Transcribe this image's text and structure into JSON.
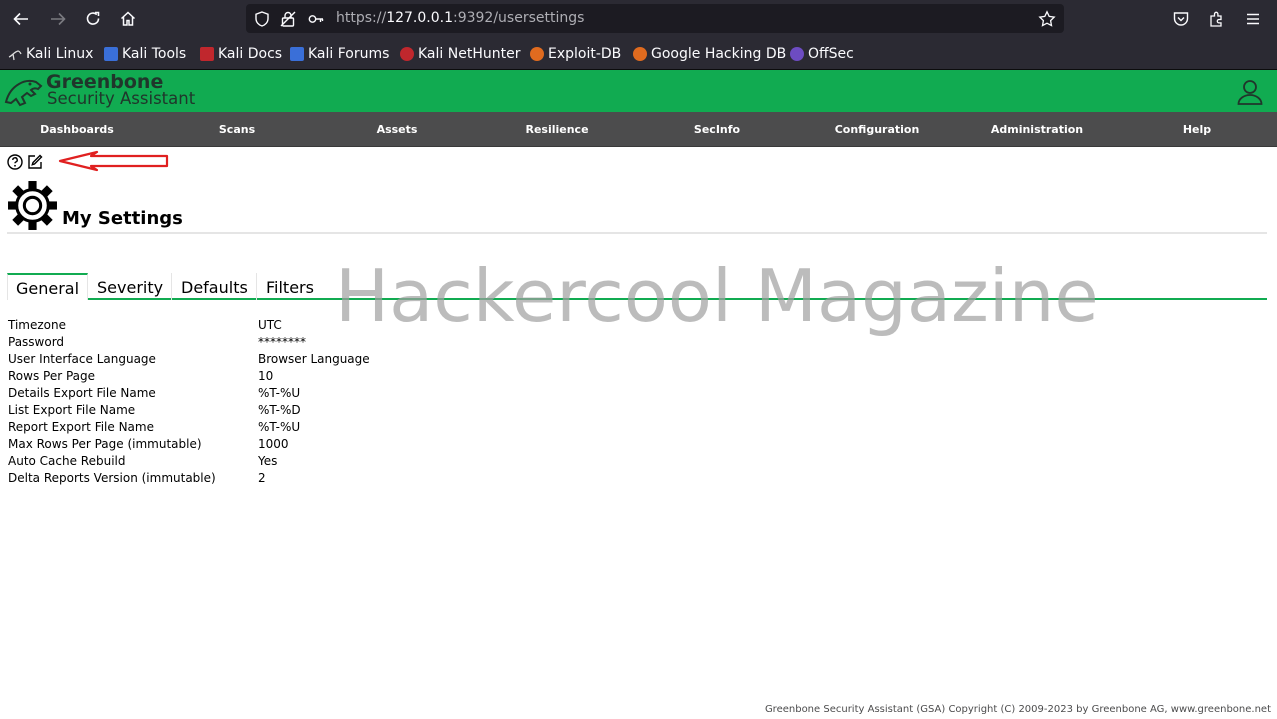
{
  "browser": {
    "url_prefix": "https://",
    "url_host": "127.0.0.1",
    "url_rest": ":9392/usersettings",
    "bookmarks": [
      {
        "label": "Kali Linux",
        "color": "#3a86c8"
      },
      {
        "label": "Kali Tools",
        "color": "#3a6fd8"
      },
      {
        "label": "Kali Docs",
        "color": "#c0272d"
      },
      {
        "label": "Kali Forums",
        "color": "#3a6fd8"
      },
      {
        "label": "Kali NetHunter",
        "color": "#c0272d"
      },
      {
        "label": "Exploit-DB",
        "color": "#e06b1f"
      },
      {
        "label": "Google Hacking DB",
        "color": "#e06b1f"
      },
      {
        "label": "OffSec",
        "color": "#6d4cc2"
      }
    ]
  },
  "app": {
    "logo_line1": "Greenbone",
    "logo_line2": "Security Assistant",
    "brand_color": "#11ab51"
  },
  "menu": [
    "Dashboards",
    "Scans",
    "Assets",
    "Resilience",
    "SecInfo",
    "Configuration",
    "Administration",
    "Help"
  ],
  "page": {
    "title": "My Settings",
    "watermark": "Hackercool Magazine"
  },
  "tabs": [
    {
      "label": "General",
      "active": true
    },
    {
      "label": "Severity",
      "active": false
    },
    {
      "label": "Defaults",
      "active": false
    },
    {
      "label": "Filters",
      "active": false
    }
  ],
  "settings": [
    {
      "label": "Timezone",
      "value": "UTC"
    },
    {
      "label": "Password",
      "value": "********"
    },
    {
      "label": "User Interface Language",
      "value": "Browser Language"
    },
    {
      "label": "Rows Per Page",
      "value": "10"
    },
    {
      "label": "Details Export File Name",
      "value": "%T-%U"
    },
    {
      "label": "List Export File Name",
      "value": "%T-%D"
    },
    {
      "label": "Report Export File Name",
      "value": "%T-%U"
    },
    {
      "label": "Max Rows Per Page (immutable)",
      "value": "1000"
    },
    {
      "label": "Auto Cache Rebuild",
      "value": "Yes"
    },
    {
      "label": "Delta Reports Version (immutable)",
      "value": "2"
    }
  ],
  "footer": "Greenbone Security Assistant (GSA) Copyright (C) 2009-2023 by Greenbone AG, www.greenbone.net"
}
